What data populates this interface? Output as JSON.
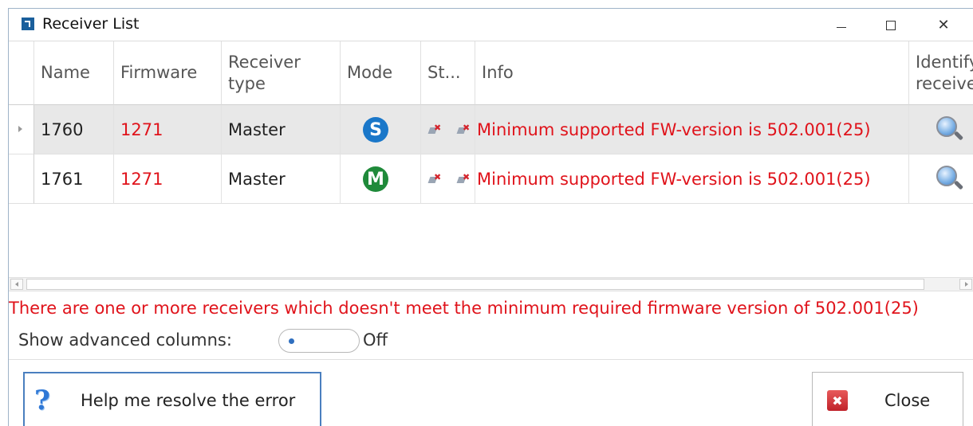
{
  "window": {
    "title": "Receiver List",
    "controls": {
      "minimize": "—",
      "maximize": "",
      "close": "✕"
    }
  },
  "grid": {
    "columns": [
      {
        "key": "name",
        "label": "Name"
      },
      {
        "key": "firmware",
        "label": "Firmware"
      },
      {
        "key": "receiver_type",
        "label": "Receiver type"
      },
      {
        "key": "mode",
        "label": "Mode"
      },
      {
        "key": "status",
        "label": "St..."
      },
      {
        "key": "info",
        "label": "Info"
      },
      {
        "key": "identify",
        "label": "Identify receiver"
      }
    ],
    "rows": [
      {
        "name": "1760",
        "firmware": "1271",
        "receiver_type": "Master",
        "mode_letter": "S",
        "mode_color": "#1a77c9",
        "info": "Minimum supported FW-version is 502.001(25)",
        "selected": true
      },
      {
        "name": "1761",
        "firmware": "1271",
        "receiver_type": "Master",
        "mode_letter": "M",
        "mode_color": "#1f8a3a",
        "info": "Minimum supported FW-version is 502.001(25)",
        "selected": false
      }
    ]
  },
  "error_message": "There are one or more receivers which doesn't meet the minimum required firmware version of 502.001(25)",
  "advanced": {
    "label": "Show advanced columns:",
    "state_text": "Off"
  },
  "buttons": {
    "help": "Help me resolve the error",
    "close": "Close"
  },
  "colors": {
    "error_red": "#e0131b",
    "selected_row": "#e8e8e8",
    "accent_blue": "#4a7fbf"
  }
}
